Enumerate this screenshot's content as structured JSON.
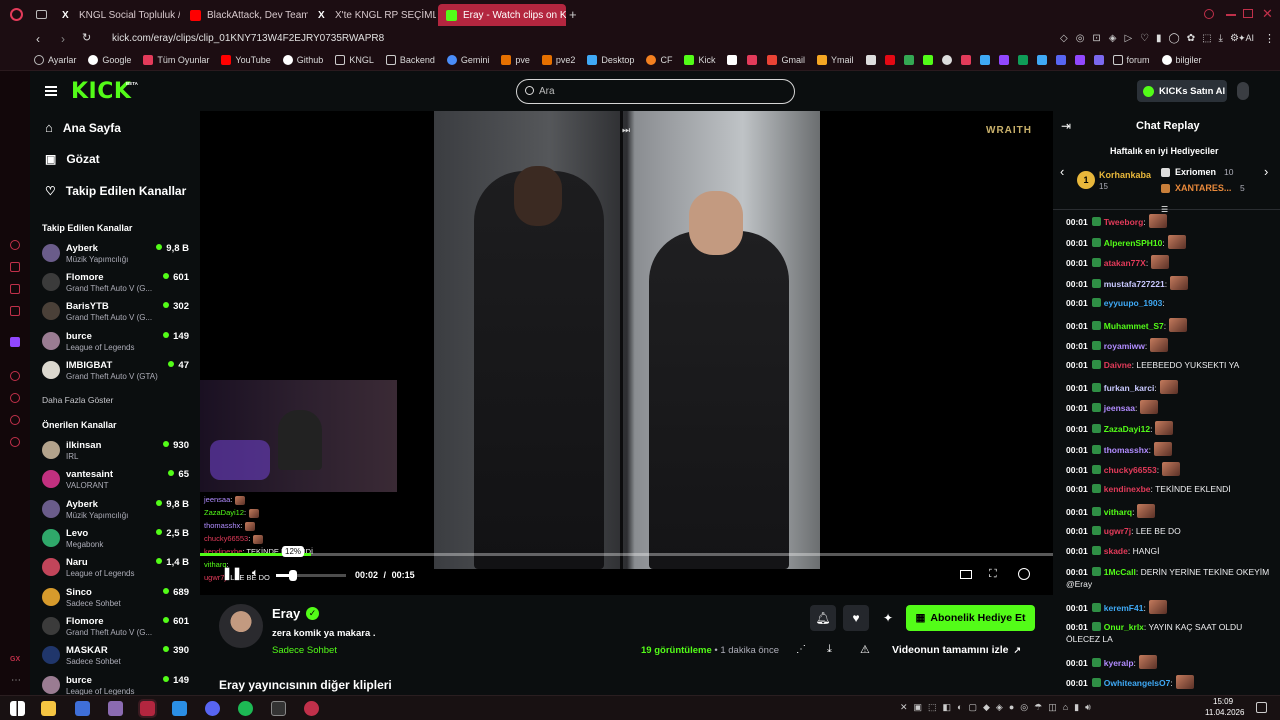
{
  "browser": {
    "tabs": [
      {
        "label": "KNGL Social Topluluk / X",
        "color": "#ffffff"
      },
      {
        "label": "BlackAttack, Dev Team de",
        "color": "#ff0000"
      },
      {
        "label": "X'te KNGL RP SEÇİMLERİ",
        "color": "#ffffff"
      },
      {
        "label": "Eray - Watch clips on K",
        "color": "#53fc18"
      }
    ],
    "new_tab": "+",
    "url": "kick.com/eray/clips/clip_01KNY713W4F2EJRY0735RWAPR8",
    "bookmarks": [
      "Ayarlar",
      "Google",
      "Tüm Oyunlar",
      "YouTube",
      "Github",
      "KNGL",
      "Backend",
      "Gemini",
      "pve",
      "pve2",
      "Desktop",
      "CF",
      "Kick",
      "Gmail",
      "Ymail",
      "forum",
      "bilgiler"
    ]
  },
  "kick": {
    "logo": "KICK",
    "logo_badge": "BETA",
    "search_placeholder": "Ara",
    "kicks_button": "KICKs Satın Al"
  },
  "sidebar": {
    "nav": [
      {
        "label": "Ana Sayfa",
        "icon": "home-icon"
      },
      {
        "label": "Gözat",
        "icon": "browse-icon"
      },
      {
        "label": "Takip Edilen Kanallar",
        "icon": "heart-icon"
      }
    ],
    "followed_title": "Takip Edilen Kanallar",
    "followed": [
      {
        "name": "Ayberk",
        "game": "Müzik Yapımcılığı",
        "viewers": "9,8 B"
      },
      {
        "name": "Flomore",
        "game": "Grand Theft Auto V (G...",
        "viewers": "601"
      },
      {
        "name": "BarisYTB",
        "game": "Grand Theft Auto V (G...",
        "viewers": "302"
      },
      {
        "name": "burce",
        "game": "League of Legends",
        "viewers": "149"
      },
      {
        "name": "IMBIGBAT",
        "game": "Grand Theft Auto V (GTA)",
        "viewers": "47"
      }
    ],
    "show_more": "Daha Fazla Göster",
    "recommended_title": "Önerilen Kanallar",
    "recommended": [
      {
        "name": "ilkinsan",
        "game": "IRL",
        "viewers": "930"
      },
      {
        "name": "vantesaint",
        "game": "VALORANT",
        "viewers": "65"
      },
      {
        "name": "Ayberk",
        "game": "Müzik Yapımcılığı",
        "viewers": "9,8 B"
      },
      {
        "name": "Levo",
        "game": "Megabonk",
        "viewers": "2,5 B"
      },
      {
        "name": "Naru",
        "game": "League of Legends",
        "viewers": "1,4 B"
      },
      {
        "name": "Sinco",
        "game": "Sadece Sohbet",
        "viewers": "689"
      },
      {
        "name": "Flomore",
        "game": "Grand Theft Auto V (G...",
        "viewers": "601"
      },
      {
        "name": "MASKAR",
        "game": "Sadece Sohbet",
        "viewers": "390"
      },
      {
        "name": "burce",
        "game": "League of Legends",
        "viewers": "149"
      }
    ]
  },
  "player": {
    "watermark": "WRAITH",
    "volume_tooltip": "12%",
    "time_current": "00:02",
    "time_sep": "/",
    "time_total": "00:15",
    "progress": 0.13,
    "overlay_chat": [
      {
        "user": "jeensaa",
        "msg": ":"
      },
      {
        "user": "ZazaDayi12",
        "msg": ":"
      },
      {
        "user": "thomasshx",
        "msg": ":"
      },
      {
        "user": "chucky66553",
        "msg": ":"
      },
      {
        "user": "kendinexbe",
        "msg": ": TEKİNDE EKLENDİ"
      },
      {
        "user": "vitharq",
        "msg": ":"
      },
      {
        "user": "ugwr7j",
        "msg": ": LEE BE DO"
      }
    ]
  },
  "clip_info": {
    "streamer": "Eray",
    "title": "zera komik ya makara .",
    "category": "Sadece Sohbet",
    "views_count": "19",
    "views_label": "görüntüleme",
    "time_ago": "• 1 dakika önce",
    "subscribe_label": "Abonelik Hediye Et",
    "watch_full": "Videonun tamamını izle",
    "more_clips": "Eray yayıncısının diğer klipleri"
  },
  "chat": {
    "title": "Chat Replay",
    "gifters_title": "Haftalık en iyi Hediyeciler",
    "gifters": [
      {
        "name": "Korhankaba",
        "count": "15",
        "rank": "1"
      },
      {
        "name": "Exriomen",
        "count": "10"
      },
      {
        "name": "XANTARES...",
        "count": "5"
      }
    ],
    "messages": [
      {
        "t": "00:01",
        "u": "Tweeborg",
        "c": "#e33b5a",
        "m": ":",
        "e": true
      },
      {
        "t": "00:01",
        "u": "AlperenSPH10",
        "c": "#53fc18",
        "m": ":",
        "e": true
      },
      {
        "t": "00:01",
        "u": "atakan77X",
        "c": "#e33b5a",
        "m": ":",
        "e": true
      },
      {
        "t": "00:01",
        "u": "mustafa727221",
        "c": "#c9c9ff",
        "m": ":",
        "e": true
      },
      {
        "t": "00:01",
        "u": "eyyuupo_1903",
        "c": "#3fa9f5",
        "m": ":",
        "e": false
      },
      {
        "t": "00:01",
        "u": "Muhammet_S7",
        "c": "#53fc18",
        "m": ":",
        "e": true
      },
      {
        "t": "00:01",
        "u": "royamiww",
        "c": "#b18cff",
        "m": ":",
        "e": true
      },
      {
        "t": "00:01",
        "u": "Daivne",
        "c": "#e33b5a",
        "m": ": LEEBEEDO YUKSEKTI YA",
        "e": false
      },
      {
        "t": "00:01",
        "u": "furkan_karci",
        "c": "#c9c9ff",
        "m": ":",
        "e": true
      },
      {
        "t": "00:01",
        "u": "jeensaa",
        "c": "#b18cff",
        "m": ":",
        "e": true
      },
      {
        "t": "00:01",
        "u": "ZazaDayi12",
        "c": "#53fc18",
        "m": ":",
        "e": true
      },
      {
        "t": "00:01",
        "u": "thomasshx",
        "c": "#b18cff",
        "m": ":",
        "e": true
      },
      {
        "t": "00:01",
        "u": "chucky66553",
        "c": "#e33b5a",
        "m": ":",
        "e": true
      },
      {
        "t": "00:01",
        "u": "kendinexbe",
        "c": "#e33b5a",
        "m": ": TEKİNDE EKLENDİ",
        "e": false
      },
      {
        "t": "00:01",
        "u": "vitharq",
        "c": "#53fc18",
        "m": ":",
        "e": true
      },
      {
        "t": "00:01",
        "u": "ugwr7j",
        "c": "#e33b5a",
        "m": ": LEE BE DO",
        "e": false
      },
      {
        "t": "00:01",
        "u": "skade",
        "c": "#e33b5a",
        "m": ": HANGİ",
        "e": false
      },
      {
        "t": "00:01",
        "u": "1McCall",
        "c": "#53fc18",
        "m": ": DERİN YERİNE TEKİNE OKEYİM @Eray",
        "e": false
      },
      {
        "t": "00:01",
        "u": "keremF41",
        "c": "#3fa9f5",
        "m": ":",
        "e": true
      },
      {
        "t": "00:01",
        "u": "Onur_krlx",
        "c": "#53fc18",
        "m": ": YAYIN KAÇ SAAT OLDU ÖLECEZ LA",
        "e": false
      },
      {
        "t": "00:01",
        "u": "kyeralp",
        "c": "#b18cff",
        "m": ":",
        "e": true
      },
      {
        "t": "00:01",
        "u": "OwhiteangelsO7",
        "c": "#3fa9f5",
        "m": ":",
        "e": true
      }
    ]
  },
  "taskbar": {
    "time": "15:09",
    "date": "11.04.2026"
  },
  "colors": {
    "kick_green": "#53fc18",
    "bg": "#0b0e0f",
    "browser_accent": "#b3263f"
  }
}
